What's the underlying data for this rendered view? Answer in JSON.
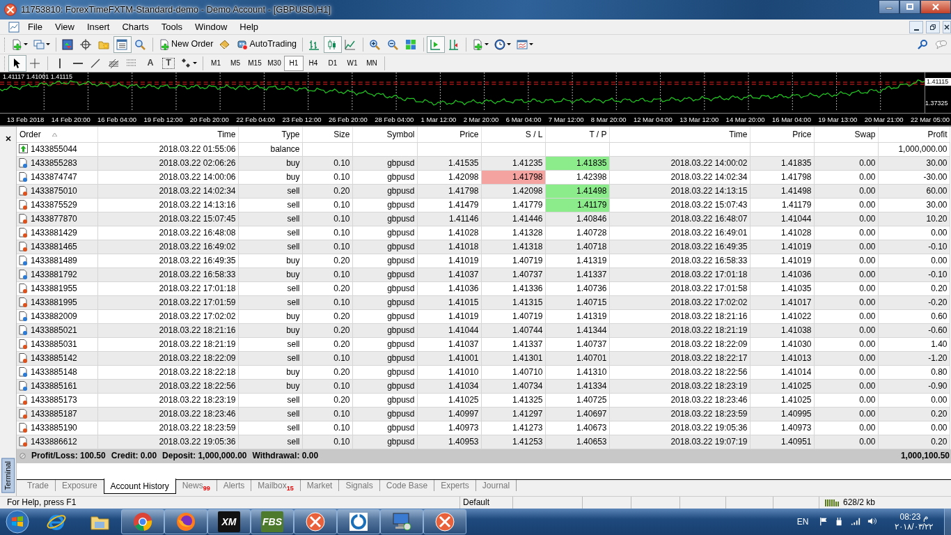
{
  "window": {
    "title": "11753810: ForexTimeFXTM-Standard-demo - Demo Account - [GBPUSD,H1]"
  },
  "menu": [
    "File",
    "View",
    "Insert",
    "Charts",
    "Tools",
    "Window",
    "Help"
  ],
  "toolbar": {
    "buttons": [
      {
        "label": "New Order"
      },
      {
        "label": "AutoTrading"
      }
    ]
  },
  "text_tools": [
    {
      "glyph": "A",
      "framed": false
    },
    {
      "glyph": "T",
      "framed": true
    }
  ],
  "timeframes": [
    {
      "label": "M1",
      "selected": false
    },
    {
      "label": "M5",
      "selected": false
    },
    {
      "label": "M15",
      "selected": false
    },
    {
      "label": "M30",
      "selected": false
    },
    {
      "label": "H1",
      "selected": true
    },
    {
      "label": "H4",
      "selected": false
    },
    {
      "label": "D1",
      "selected": false
    },
    {
      "label": "W1",
      "selected": false
    },
    {
      "label": "MN",
      "selected": false
    }
  ],
  "chart": {
    "ohlc_text": "1.41117 1.41001 1.41115",
    "price_labels": [
      {
        "text": "1.41115",
        "current": true
      },
      {
        "text": "1.37325",
        "current": false
      }
    ],
    "time_labels": [
      "13 Feb 2018",
      "14 Feb 20:00",
      "16 Feb 04:00",
      "19 Feb 12:00",
      "20 Feb 20:00",
      "22 Feb 04:00",
      "23 Feb 12:00",
      "26 Feb 20:00",
      "28 Feb 04:00",
      "1 Mar 12:00",
      "2 Mar 20:00",
      "6 Mar 04:00",
      "7 Mar 12:00",
      "8 Mar 20:00",
      "12 Mar 04:00",
      "13 Mar 12:00",
      "14 Mar 20:00",
      "16 Mar 04:00",
      "19 Mar 13:00",
      "20 Mar 21:00",
      "22 Mar 05:00"
    ]
  },
  "terminal": {
    "title": "Terminal"
  },
  "table": {
    "columns": [
      {
        "label": "Order",
        "sorted": true
      },
      {
        "label": "Time",
        "sorted": false
      },
      {
        "label": "Type",
        "sorted": false
      },
      {
        "label": "Size",
        "sorted": false
      },
      {
        "label": "Symbol",
        "sorted": false
      },
      {
        "label": "Price",
        "sorted": false
      },
      {
        "label": "S / L",
        "sorted": false
      },
      {
        "label": "T / P",
        "sorted": false
      },
      {
        "label": "Time",
        "sorted": false
      },
      {
        "label": "Price",
        "sorted": false
      },
      {
        "label": "Swap",
        "sorted": false
      },
      {
        "label": "Profit",
        "sorted": false
      }
    ],
    "rows": [
      {
        "kind": "balance",
        "order": "1433855044",
        "time": "2018.03.22 01:55:06",
        "type": "balance",
        "profit": "1,000,000.00",
        "sl_hit": false,
        "tp_hit": false
      },
      {
        "kind": "buy",
        "order": "1433855283",
        "time": "2018.03.22 02:06:26",
        "type": "buy",
        "size": "0.10",
        "symbol": "gbpusd",
        "price": "1.41535",
        "sl": "1.41235",
        "tp": "1.41835",
        "close_time": "2018.03.22 14:00:02",
        "close_price": "1.41835",
        "swap": "0.00",
        "profit": "30.00",
        "sl_hit": false,
        "tp_hit": true
      },
      {
        "kind": "buy",
        "order": "1433874747",
        "time": "2018.03.22 14:00:06",
        "type": "buy",
        "size": "0.10",
        "symbol": "gbpusd",
        "price": "1.42098",
        "sl": "1.41798",
        "tp": "1.42398",
        "close_time": "2018.03.22 14:02:34",
        "close_price": "1.41798",
        "swap": "0.00",
        "profit": "-30.00",
        "sl_hit": true,
        "tp_hit": false
      },
      {
        "kind": "sell",
        "order": "1433875010",
        "time": "2018.03.22 14:02:34",
        "type": "sell",
        "size": "0.20",
        "symbol": "gbpusd",
        "price": "1.41798",
        "sl": "1.42098",
        "tp": "1.41498",
        "close_time": "2018.03.22 14:13:15",
        "close_price": "1.41498",
        "swap": "0.00",
        "profit": "60.00",
        "sl_hit": false,
        "tp_hit": true
      },
      {
        "kind": "sell",
        "order": "1433875529",
        "time": "2018.03.22 14:13:16",
        "type": "sell",
        "size": "0.10",
        "symbol": "gbpusd",
        "price": "1.41479",
        "sl": "1.41779",
        "tp": "1.41179",
        "close_time": "2018.03.22 15:07:43",
        "close_price": "1.41179",
        "swap": "0.00",
        "profit": "30.00",
        "sl_hit": false,
        "tp_hit": true
      },
      {
        "kind": "sell",
        "order": "1433877870",
        "time": "2018.03.22 15:07:45",
        "type": "sell",
        "size": "0.10",
        "symbol": "gbpusd",
        "price": "1.41146",
        "sl": "1.41446",
        "tp": "1.40846",
        "close_time": "2018.03.22 16:48:07",
        "close_price": "1.41044",
        "swap": "0.00",
        "profit": "10.20",
        "sl_hit": false,
        "tp_hit": false
      },
      {
        "kind": "sell",
        "order": "1433881429",
        "time": "2018.03.22 16:48:08",
        "type": "sell",
        "size": "0.10",
        "symbol": "gbpusd",
        "price": "1.41028",
        "sl": "1.41328",
        "tp": "1.40728",
        "close_time": "2018.03.22 16:49:01",
        "close_price": "1.41028",
        "swap": "0.00",
        "profit": "0.00",
        "sl_hit": false,
        "tp_hit": false
      },
      {
        "kind": "sell",
        "order": "1433881465",
        "time": "2018.03.22 16:49:02",
        "type": "sell",
        "size": "0.10",
        "symbol": "gbpusd",
        "price": "1.41018",
        "sl": "1.41318",
        "tp": "1.40718",
        "close_time": "2018.03.22 16:49:35",
        "close_price": "1.41019",
        "swap": "0.00",
        "profit": "-0.10",
        "sl_hit": false,
        "tp_hit": false
      },
      {
        "kind": "buy",
        "order": "1433881489",
        "time": "2018.03.22 16:49:35",
        "type": "buy",
        "size": "0.20",
        "symbol": "gbpusd",
        "price": "1.41019",
        "sl": "1.40719",
        "tp": "1.41319",
        "close_time": "2018.03.22 16:58:33",
        "close_price": "1.41019",
        "swap": "0.00",
        "profit": "0.00",
        "sl_hit": false,
        "tp_hit": false
      },
      {
        "kind": "buy",
        "order": "1433881792",
        "time": "2018.03.22 16:58:33",
        "type": "buy",
        "size": "0.10",
        "symbol": "gbpusd",
        "price": "1.41037",
        "sl": "1.40737",
        "tp": "1.41337",
        "close_time": "2018.03.22 17:01:18",
        "close_price": "1.41036",
        "swap": "0.00",
        "profit": "-0.10",
        "sl_hit": false,
        "tp_hit": false
      },
      {
        "kind": "sell",
        "order": "1433881955",
        "time": "2018.03.22 17:01:18",
        "type": "sell",
        "size": "0.20",
        "symbol": "gbpusd",
        "price": "1.41036",
        "sl": "1.41336",
        "tp": "1.40736",
        "close_time": "2018.03.22 17:01:58",
        "close_price": "1.41035",
        "swap": "0.00",
        "profit": "0.20",
        "sl_hit": false,
        "tp_hit": false
      },
      {
        "kind": "sell",
        "order": "1433881995",
        "time": "2018.03.22 17:01:59",
        "type": "sell",
        "size": "0.10",
        "symbol": "gbpusd",
        "price": "1.41015",
        "sl": "1.41315",
        "tp": "1.40715",
        "close_time": "2018.03.22 17:02:02",
        "close_price": "1.41017",
        "swap": "0.00",
        "profit": "-0.20",
        "sl_hit": false,
        "tp_hit": false
      },
      {
        "kind": "buy",
        "order": "1433882009",
        "time": "2018.03.22 17:02:02",
        "type": "buy",
        "size": "0.20",
        "symbol": "gbpusd",
        "price": "1.41019",
        "sl": "1.40719",
        "tp": "1.41319",
        "close_time": "2018.03.22 18:21:16",
        "close_price": "1.41022",
        "swap": "0.00",
        "profit": "0.60",
        "sl_hit": false,
        "tp_hit": false
      },
      {
        "kind": "buy",
        "order": "1433885021",
        "time": "2018.03.22 18:21:16",
        "type": "buy",
        "size": "0.20",
        "symbol": "gbpusd",
        "price": "1.41044",
        "sl": "1.40744",
        "tp": "1.41344",
        "close_time": "2018.03.22 18:21:19",
        "close_price": "1.41038",
        "swap": "0.00",
        "profit": "-0.60",
        "sl_hit": false,
        "tp_hit": false
      },
      {
        "kind": "sell",
        "order": "1433885031",
        "time": "2018.03.22 18:21:19",
        "type": "sell",
        "size": "0.20",
        "symbol": "gbpusd",
        "price": "1.41037",
        "sl": "1.41337",
        "tp": "1.40737",
        "close_time": "2018.03.22 18:22:09",
        "close_price": "1.41030",
        "swap": "0.00",
        "profit": "1.40",
        "sl_hit": false,
        "tp_hit": false
      },
      {
        "kind": "sell",
        "order": "1433885142",
        "time": "2018.03.22 18:22:09",
        "type": "sell",
        "size": "0.10",
        "symbol": "gbpusd",
        "price": "1.41001",
        "sl": "1.41301",
        "tp": "1.40701",
        "close_time": "2018.03.22 18:22:17",
        "close_price": "1.41013",
        "swap": "0.00",
        "profit": "-1.20",
        "sl_hit": false,
        "tp_hit": false
      },
      {
        "kind": "buy",
        "order": "1433885148",
        "time": "2018.03.22 18:22:18",
        "type": "buy",
        "size": "0.20",
        "symbol": "gbpusd",
        "price": "1.41010",
        "sl": "1.40710",
        "tp": "1.41310",
        "close_time": "2018.03.22 18:22:56",
        "close_price": "1.41014",
        "swap": "0.00",
        "profit": "0.80",
        "sl_hit": false,
        "tp_hit": false
      },
      {
        "kind": "buy",
        "order": "1433885161",
        "time": "2018.03.22 18:22:56",
        "type": "buy",
        "size": "0.10",
        "symbol": "gbpusd",
        "price": "1.41034",
        "sl": "1.40734",
        "tp": "1.41334",
        "close_time": "2018.03.22 18:23:19",
        "close_price": "1.41025",
        "swap": "0.00",
        "profit": "-0.90",
        "sl_hit": false,
        "tp_hit": false
      },
      {
        "kind": "sell",
        "order": "1433885173",
        "time": "2018.03.22 18:23:19",
        "type": "sell",
        "size": "0.20",
        "symbol": "gbpusd",
        "price": "1.41025",
        "sl": "1.41325",
        "tp": "1.40725",
        "close_time": "2018.03.22 18:23:46",
        "close_price": "1.41025",
        "swap": "0.00",
        "profit": "0.00",
        "sl_hit": false,
        "tp_hit": false
      },
      {
        "kind": "sell",
        "order": "1433885187",
        "time": "2018.03.22 18:23:46",
        "type": "sell",
        "size": "0.10",
        "symbol": "gbpusd",
        "price": "1.40997",
        "sl": "1.41297",
        "tp": "1.40697",
        "close_time": "2018.03.22 18:23:59",
        "close_price": "1.40995",
        "swap": "0.00",
        "profit": "0.20",
        "sl_hit": false,
        "tp_hit": false
      },
      {
        "kind": "sell",
        "order": "1433885190",
        "time": "2018.03.22 18:23:59",
        "type": "sell",
        "size": "0.10",
        "symbol": "gbpusd",
        "price": "1.40973",
        "sl": "1.41273",
        "tp": "1.40673",
        "close_time": "2018.03.22 19:05:36",
        "close_price": "1.40973",
        "swap": "0.00",
        "profit": "0.00",
        "sl_hit": false,
        "tp_hit": false
      },
      {
        "kind": "sell",
        "order": "1433886612",
        "time": "2018.03.22 19:05:36",
        "type": "sell",
        "size": "0.10",
        "symbol": "gbpusd",
        "price": "1.40953",
        "sl": "1.41253",
        "tp": "1.40653",
        "close_time": "2018.03.22 19:07:19",
        "close_price": "1.40951",
        "swap": "0.00",
        "profit": "0.20",
        "sl_hit": false,
        "tp_hit": false
      }
    ]
  },
  "summary": {
    "items": [
      "Profit/Loss: 100.50",
      "Credit: 0.00",
      "Deposit: 1,000,000.00",
      "Withdrawal: 0.00"
    ],
    "total": "1,000,100.50"
  },
  "tabs": [
    {
      "label": "Trade",
      "selected": false
    },
    {
      "label": "Exposure",
      "selected": false
    },
    {
      "label": "Account History",
      "selected": true
    },
    {
      "label": "News",
      "count": "99",
      "selected": false
    },
    {
      "label": "Alerts",
      "selected": false
    },
    {
      "label": "Mailbox",
      "count": "15",
      "selected": false
    },
    {
      "label": "Market",
      "selected": false
    },
    {
      "label": "Signals",
      "selected": false
    },
    {
      "label": "Code Base",
      "selected": false
    },
    {
      "label": "Experts",
      "selected": false
    },
    {
      "label": "Journal",
      "selected": false
    }
  ],
  "status_bar": {
    "help": "For Help, press F1",
    "profile": "Default",
    "traffic": "628/2 kb"
  },
  "taskbar": {
    "apps": [
      {
        "kind": "ie",
        "running": false
      },
      {
        "kind": "folder",
        "running": false
      },
      {
        "kind": "chrome",
        "running": true
      },
      {
        "kind": "firefox",
        "running": true
      },
      {
        "kind": "logo",
        "logo_text": "XM",
        "color": "#111111",
        "running": true
      },
      {
        "kind": "logo",
        "logo_text": "FBS",
        "color": "#4e7a2e",
        "running": true
      },
      {
        "kind": "mt4",
        "running": true
      },
      {
        "kind": "ring",
        "running": true
      },
      {
        "kind": "remote",
        "running": true
      },
      {
        "kind": "mt4",
        "running": true
      }
    ],
    "language": "EN",
    "time": "08:23 م",
    "date": "٢٠١٨/٠٣/٢٢"
  }
}
